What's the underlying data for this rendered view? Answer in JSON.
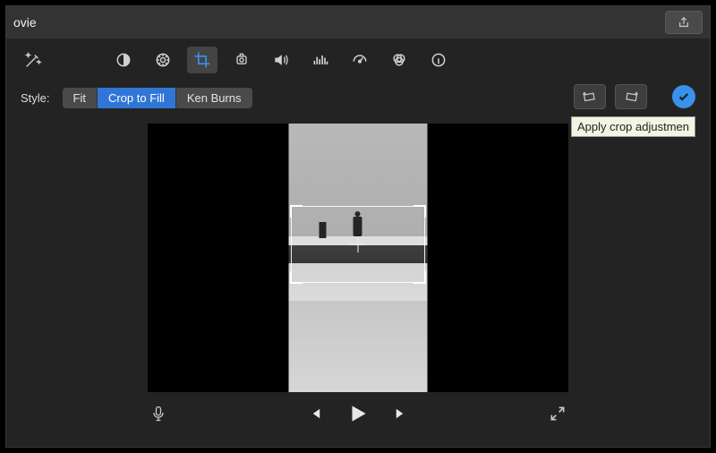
{
  "window": {
    "title": "ovie"
  },
  "toolbar": {
    "icons": {
      "wand": "magic-wand-icon",
      "balance": "color-balance-icon",
      "palette": "color-correction-icon",
      "crop": "crop-icon",
      "stabilize": "stabilization-icon",
      "volume": "volume-icon",
      "eq": "noise-eq-icon",
      "speed": "speed-icon",
      "filter": "clip-filter-icon",
      "info": "clip-info-icon"
    },
    "active": "crop"
  },
  "style": {
    "label": "Style:",
    "options": [
      "Fit",
      "Crop to Fill",
      "Ken Burns"
    ],
    "selected": "Crop to Fill"
  },
  "crop_controls": {
    "rotate_ccw": "rotate-ccw-icon",
    "rotate_cw": "rotate-cw-icon",
    "apply_tooltip": "Apply crop adjustmen"
  },
  "transport": {
    "mic": "voiceover-mic-icon",
    "prev": "prev-frame-icon",
    "play": "play-icon",
    "next": "next-frame-icon",
    "expand": "fullscreen-icon"
  }
}
